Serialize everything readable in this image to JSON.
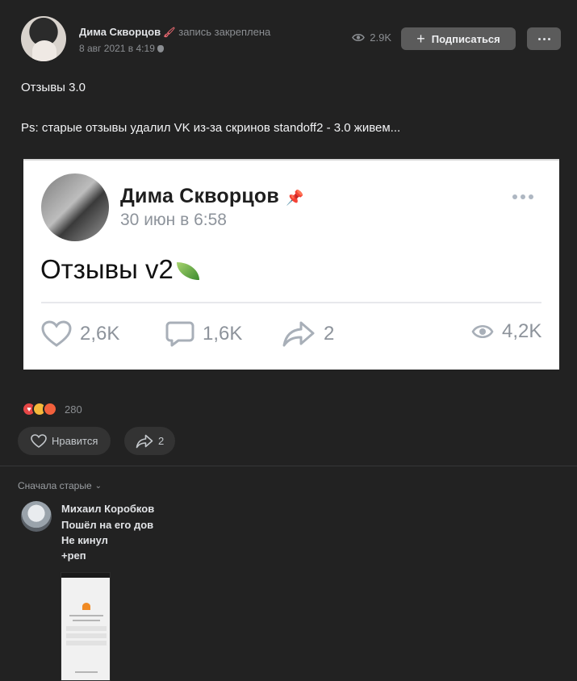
{
  "post": {
    "author": "Дима Скворцов",
    "pinned_note": "запись закреплена",
    "date": "8 авг 2021 в 4:19",
    "views": "2.9K",
    "subscribe_label": "Подписаться",
    "text_line1": "Отзывы 3.0",
    "text_line2": "Ps: старые отзывы удалил VK из-за скринов standoff2 - 3.0 живем..."
  },
  "embedded": {
    "author": "Дима Скворцов",
    "date": "30 июн в 6:58",
    "title": "Отзывы v2",
    "likes": "2,6K",
    "comments": "1,6K",
    "shares": "2",
    "views": "4,2K"
  },
  "reactions": {
    "count": "280",
    "icons": [
      "heart-icon",
      "laughing-face-icon",
      "angry-face-icon"
    ]
  },
  "actions": {
    "like_label": "Нравится",
    "share_count": "2"
  },
  "comments": {
    "sort_label": "Сначала старые",
    "items": [
      {
        "author": "Михаил Коробков",
        "lines": [
          "Пошёл на его дов",
          "Не кинул",
          "+реп"
        ]
      }
    ]
  },
  "colors": {
    "background": "#222222",
    "button": "#5b5b5b",
    "muted_text": "#8b8e92",
    "heart": "#e64646"
  }
}
